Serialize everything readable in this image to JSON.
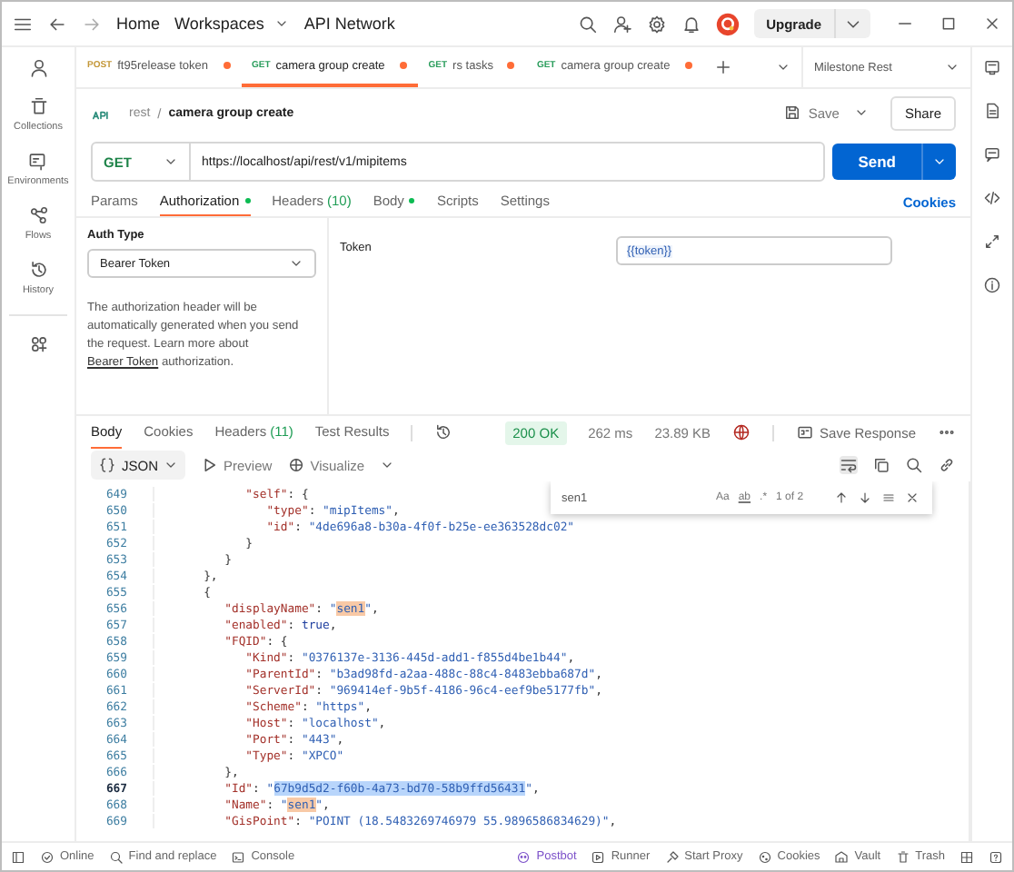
{
  "title_bar": {
    "nav": [
      {
        "label": "Home",
        "dropdown": false
      },
      {
        "label": "Workspaces",
        "dropdown": true
      },
      {
        "label": "API Network",
        "dropdown": false
      }
    ],
    "upgrade": "Upgrade"
  },
  "sidebar": {
    "items": [
      {
        "label": "Collections"
      },
      {
        "label": "Environments"
      },
      {
        "label": "Flows"
      },
      {
        "label": "History"
      }
    ]
  },
  "tabs": [
    {
      "method": "POST",
      "color": "#c4983a",
      "title": "ft95release token",
      "modified": true,
      "selected": false
    },
    {
      "method": "GET",
      "color": "#2a9d5c",
      "title": "camera group create",
      "modified": true,
      "selected": true
    },
    {
      "method": "GET",
      "color": "#2a9d5c",
      "title": "rs tasks",
      "modified": true,
      "selected": false
    },
    {
      "method": "GET",
      "color": "#2a9d5c",
      "title": "camera group create",
      "modified": true,
      "selected": false
    }
  ],
  "environment": "Milestone Rest",
  "breadcrumb": {
    "parent": "rest",
    "separator": "/",
    "name": "camera group create"
  },
  "save": "Save",
  "share": "Share",
  "request": {
    "method": "GET",
    "url": "https://localhost/api/rest/v1/mipitems",
    "send": "Send"
  },
  "request_tabs": [
    {
      "label": "Params",
      "selected": false,
      "dot": false
    },
    {
      "label": "Authorization",
      "selected": true,
      "dot": true
    },
    {
      "label": "Headers",
      "count": "(10)",
      "selected": false,
      "dot": false
    },
    {
      "label": "Body",
      "selected": false,
      "dot": true
    },
    {
      "label": "Scripts",
      "selected": false,
      "dot": false
    },
    {
      "label": "Settings",
      "selected": false,
      "dot": false
    }
  ],
  "cookies_link": "Cookies",
  "auth": {
    "type_label": "Auth Type",
    "type": "Bearer Token",
    "description": "The authorization header will be automatically generated when you send the request. Learn more about",
    "link": "Bearer Token",
    "description_end": "authorization.",
    "token_label": "Token",
    "token": "{{token}}"
  },
  "response_tabs": [
    {
      "label": "Body",
      "selected": true
    },
    {
      "label": "Cookies",
      "selected": false
    },
    {
      "label": "Headers",
      "count": "(11)",
      "selected": false
    },
    {
      "label": "Test Results",
      "selected": false
    }
  ],
  "response_meta": {
    "status": "200 OK",
    "time": "262 ms",
    "size": "23.89 KB",
    "save": "Save Response"
  },
  "viewer": {
    "format": "JSON",
    "preview": "Preview",
    "visualize": "Visualize"
  },
  "find": {
    "value": "sen1",
    "case_option": "Aa",
    "word_option": "ab",
    "regex_option": ".*",
    "count": "1 of 2"
  },
  "code_lines": [
    {
      "number": "649",
      "current": false,
      "parts": [
        {
          "kind": "key",
          "text": "            \"self\""
        },
        {
          "kind": "punct",
          "text": ": {"
        }
      ]
    },
    {
      "number": "650",
      "current": false,
      "parts": [
        {
          "kind": "key",
          "text": "               \"type\""
        },
        {
          "kind": "punct",
          "text": ": "
        },
        {
          "kind": "str",
          "text": "\"mipItems\""
        },
        {
          "kind": "punct",
          "text": ","
        }
      ]
    },
    {
      "number": "651",
      "current": false,
      "parts": [
        {
          "kind": "key",
          "text": "               \"id\""
        },
        {
          "kind": "punct",
          "text": ": "
        },
        {
          "kind": "str",
          "text": "\"4de696a8-b30a-4f0f-b25e-ee363528dc02\""
        }
      ]
    },
    {
      "number": "652",
      "current": false,
      "parts": [
        {
          "kind": "punct",
          "text": "            }"
        }
      ]
    },
    {
      "number": "653",
      "current": false,
      "parts": [
        {
          "kind": "punct",
          "text": "         }"
        }
      ]
    },
    {
      "number": "654",
      "current": false,
      "parts": [
        {
          "kind": "punct",
          "text": "      },"
        }
      ]
    },
    {
      "number": "655",
      "current": false,
      "parts": [
        {
          "kind": "punct",
          "text": "      {"
        }
      ]
    },
    {
      "number": "656",
      "current": false,
      "parts": [
        {
          "kind": "key",
          "text": "         \"displayName\""
        },
        {
          "kind": "punct",
          "text": ": "
        },
        {
          "kind": "str",
          "text": "\""
        },
        {
          "kind": "match",
          "text": "sen1"
        },
        {
          "kind": "str",
          "text": "\""
        },
        {
          "kind": "punct",
          "text": ","
        }
      ]
    },
    {
      "number": "657",
      "current": false,
      "parts": [
        {
          "kind": "key",
          "text": "         \"enabled\""
        },
        {
          "kind": "punct",
          "text": ": "
        },
        {
          "kind": "lit",
          "text": "true"
        },
        {
          "kind": "punct",
          "text": ","
        }
      ]
    },
    {
      "number": "658",
      "current": false,
      "parts": [
        {
          "kind": "key",
          "text": "         \"FQID\""
        },
        {
          "kind": "punct",
          "text": ": {"
        }
      ]
    },
    {
      "number": "659",
      "current": false,
      "parts": [
        {
          "kind": "key",
          "text": "            \"Kind\""
        },
        {
          "kind": "punct",
          "text": ": "
        },
        {
          "kind": "str",
          "text": "\"0376137e-3136-445d-add1-f855d4be1b44\""
        },
        {
          "kind": "punct",
          "text": ","
        }
      ]
    },
    {
      "number": "660",
      "current": false,
      "parts": [
        {
          "kind": "key",
          "text": "            \"ParentId\""
        },
        {
          "kind": "punct",
          "text": ": "
        },
        {
          "kind": "str",
          "text": "\"b3ad98fd-a2aa-488c-88c4-8483ebba687d\""
        },
        {
          "kind": "punct",
          "text": ","
        }
      ]
    },
    {
      "number": "661",
      "current": false,
      "parts": [
        {
          "kind": "key",
          "text": "            \"ServerId\""
        },
        {
          "kind": "punct",
          "text": ": "
        },
        {
          "kind": "str",
          "text": "\"969414ef-9b5f-4186-96c4-eef9be5177fb\""
        },
        {
          "kind": "punct",
          "text": ","
        }
      ]
    },
    {
      "number": "662",
      "current": false,
      "parts": [
        {
          "kind": "key",
          "text": "            \"Scheme\""
        },
        {
          "kind": "punct",
          "text": ": "
        },
        {
          "kind": "str",
          "text": "\"https\""
        },
        {
          "kind": "punct",
          "text": ","
        }
      ]
    },
    {
      "number": "663",
      "current": false,
      "parts": [
        {
          "kind": "key",
          "text": "            \"Host\""
        },
        {
          "kind": "punct",
          "text": ": "
        },
        {
          "kind": "str",
          "text": "\"localhost\""
        },
        {
          "kind": "punct",
          "text": ","
        }
      ]
    },
    {
      "number": "664",
      "current": false,
      "parts": [
        {
          "kind": "key",
          "text": "            \"Port\""
        },
        {
          "kind": "punct",
          "text": ": "
        },
        {
          "kind": "str",
          "text": "\"443\""
        },
        {
          "kind": "punct",
          "text": ","
        }
      ]
    },
    {
      "number": "665",
      "current": false,
      "parts": [
        {
          "kind": "key",
          "text": "            \"Type\""
        },
        {
          "kind": "punct",
          "text": ": "
        },
        {
          "kind": "str",
          "text": "\"XPCO\""
        }
      ]
    },
    {
      "number": "666",
      "current": false,
      "parts": [
        {
          "kind": "punct",
          "text": "         },"
        }
      ]
    },
    {
      "number": "667",
      "current": true,
      "parts": [
        {
          "kind": "key",
          "text": "         \"Id\""
        },
        {
          "kind": "punct",
          "text": ": "
        },
        {
          "kind": "str",
          "text": "\""
        },
        {
          "kind": "sel",
          "text": "67b9d5d2-f60b-4a73-bd70-58b9ffd56431"
        },
        {
          "kind": "str",
          "text": "\""
        },
        {
          "kind": "punct",
          "text": ","
        }
      ]
    },
    {
      "number": "668",
      "current": false,
      "parts": [
        {
          "kind": "key",
          "text": "         \"Name\""
        },
        {
          "kind": "punct",
          "text": ": "
        },
        {
          "kind": "str",
          "text": "\""
        },
        {
          "kind": "match",
          "text": "sen1"
        },
        {
          "kind": "str",
          "text": "\""
        },
        {
          "kind": "punct",
          "text": ","
        }
      ]
    },
    {
      "number": "669",
      "current": false,
      "parts": [
        {
          "kind": "key",
          "text": "         \"GisPoint\""
        },
        {
          "kind": "punct",
          "text": ": "
        },
        {
          "kind": "str",
          "text": "\"POINT (18.5483269746979 55.9896586834629)\""
        },
        {
          "kind": "punct",
          "text": ","
        }
      ]
    }
  ],
  "status_bar": {
    "left": [
      "Online",
      "Find and replace",
      "Console"
    ],
    "right": [
      "Postbot",
      "Runner",
      "Start Proxy",
      "Cookies",
      "Vault",
      "Trash"
    ]
  }
}
